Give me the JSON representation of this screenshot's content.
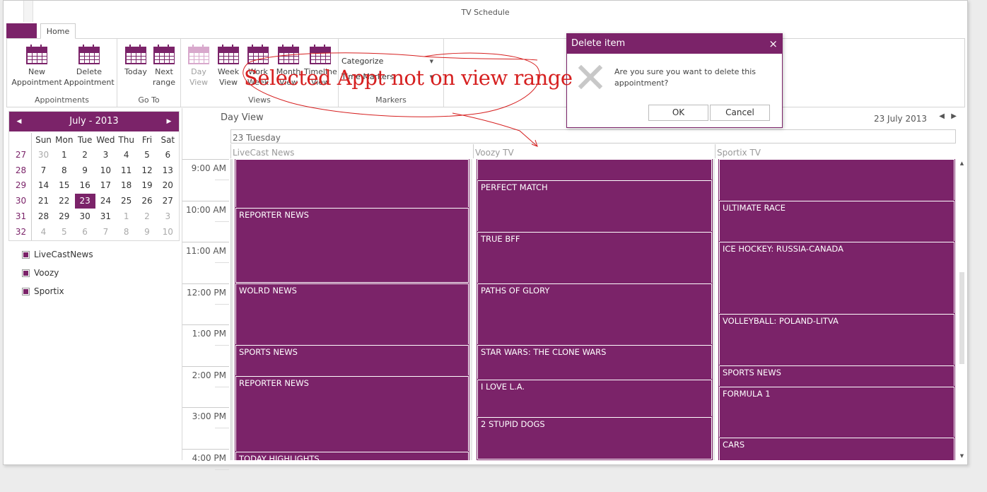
{
  "window": {
    "title": "TV Schedule"
  },
  "ribbon": {
    "tab_home": "Home",
    "groups": {
      "appointments": "Appointments",
      "goto": "Go To",
      "views": "Views",
      "markers": "Markers"
    },
    "buttons": {
      "new_appointment": [
        "New",
        "Appointment"
      ],
      "delete_appointment": [
        "Delete",
        "Appointment"
      ],
      "today": "Today",
      "next_range": [
        "Next",
        "range"
      ],
      "day_view": [
        "Day",
        "View"
      ],
      "week_view": [
        "Week",
        "View"
      ],
      "work_week": [
        "Work",
        "Week"
      ],
      "month_view": [
        "Month",
        "View"
      ],
      "timeline_view": [
        "Timeline",
        "View"
      ]
    },
    "categorize": "Categorize",
    "time_markers": "Time Markers"
  },
  "mini_calendar": {
    "month_label": "July - 2013",
    "day_names": [
      "Sun",
      "Mon",
      "Tue",
      "Wed",
      "Thu",
      "Fri",
      "Sat"
    ],
    "weeks": [
      {
        "num": "27",
        "days": [
          "30",
          "1",
          "2",
          "3",
          "4",
          "5",
          "6"
        ]
      },
      {
        "num": "28",
        "days": [
          "7",
          "8",
          "9",
          "10",
          "11",
          "12",
          "13"
        ]
      },
      {
        "num": "29",
        "days": [
          "14",
          "15",
          "16",
          "17",
          "18",
          "19",
          "20"
        ]
      },
      {
        "num": "30",
        "days": [
          "21",
          "22",
          "23",
          "24",
          "25",
          "26",
          "27"
        ]
      },
      {
        "num": "31",
        "days": [
          "28",
          "29",
          "30",
          "31",
          "1",
          "2",
          "3"
        ]
      },
      {
        "num": "32",
        "days": [
          "4",
          "5",
          "6",
          "7",
          "8",
          "9",
          "10"
        ]
      }
    ],
    "selected": "23"
  },
  "resources": [
    "LiveCastNews",
    "Voozy",
    "Sportix"
  ],
  "scheduler": {
    "view_title": "Day View",
    "date_label": "23 July 2013",
    "day_header": "23 Tuesday",
    "columns": [
      "LiveCast News",
      "Voozy TV",
      "Sportix TV"
    ],
    "times": [
      "9:00 AM",
      "10:00 AM",
      "11:00 AM",
      "12:00 PM",
      "1:00 PM",
      "2:00 PM",
      "3:00 PM",
      "4:00 PM"
    ],
    "appointments": {
      "livecast": [
        "",
        "REPORTER NEWS",
        "WOLRD NEWS",
        "SPORTS NEWS",
        "REPORTER NEWS",
        "TODAY HIGHLIGHTS"
      ],
      "voozy": [
        "",
        "PERFECT MATCH",
        "TRUE BFF",
        "PATHS OF GLORY",
        "STAR WARS: THE CLONE WARS",
        "I LOVE L.A.",
        "2 STUPID DOGS"
      ],
      "sportix": [
        "",
        "ULTIMATE RACE",
        "ICE HOCKEY: RUSSIA-CANADA",
        "VOLLEYBALL: POLAND-LITVA",
        "SPORTS NEWS",
        "FORMULA 1",
        "CARS"
      ]
    }
  },
  "dialog": {
    "title": "Delete item",
    "message": "Are you sure you want to delete this appointment?",
    "ok": "OK",
    "cancel": "Cancel"
  },
  "annotation": "Selected Appt not on view range",
  "colors": {
    "accent": "#7b2369",
    "annotation": "#d62020"
  }
}
